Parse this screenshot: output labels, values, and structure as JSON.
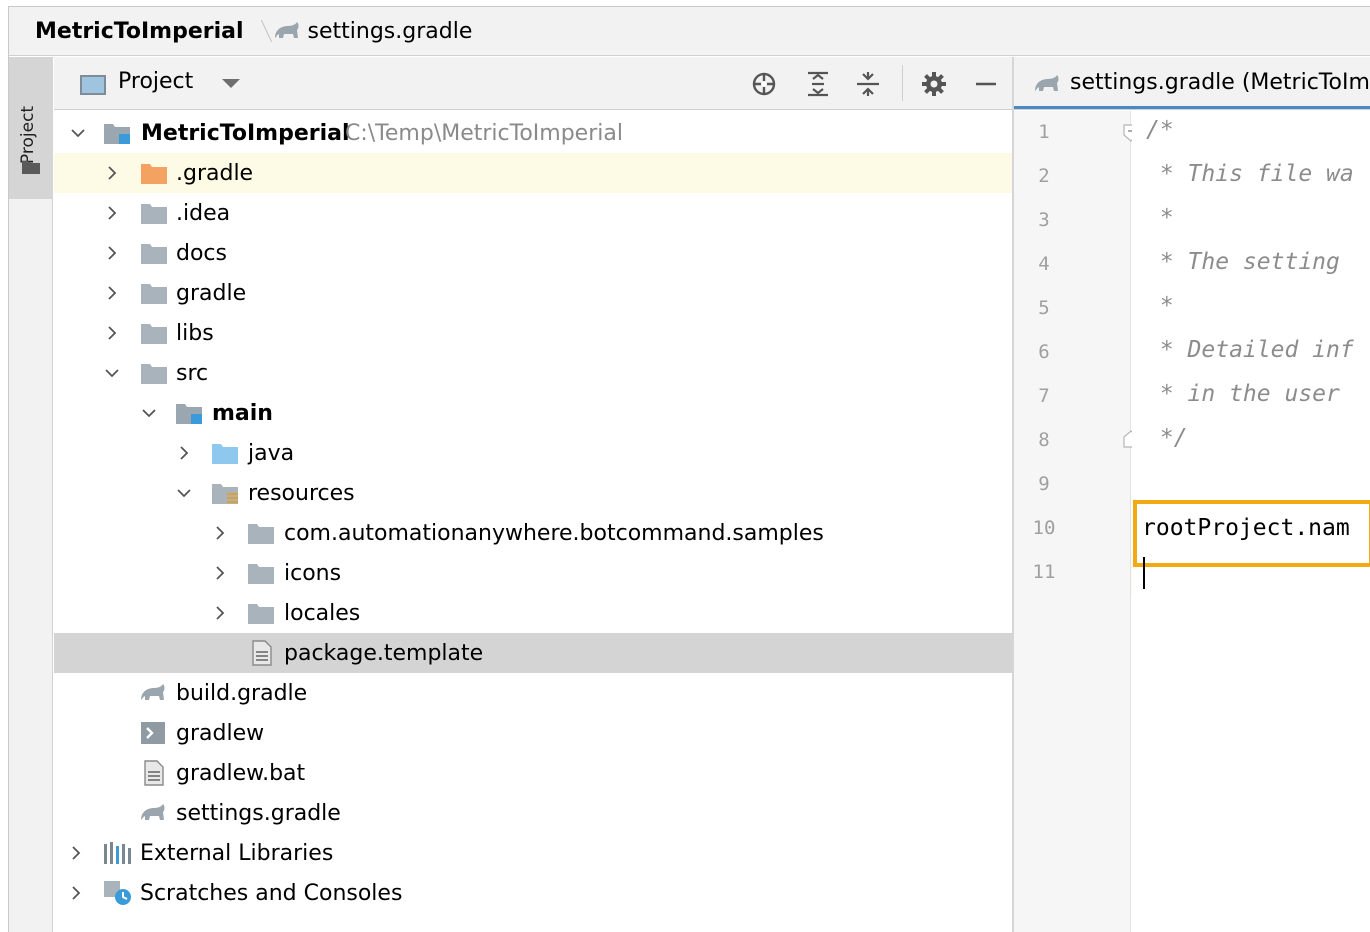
{
  "navbar": {
    "project": "MetricToImperial",
    "file": "settings.gradle"
  },
  "stripe": {
    "label": "Project"
  },
  "project_panel": {
    "title": "Project",
    "toolbar": [
      "locate-icon",
      "expand-all-icon",
      "collapse-all-icon",
      "settings-icon",
      "hide-icon"
    ]
  },
  "tree": {
    "root": {
      "label": "MetricToImperial",
      "path": "C:\\Temp\\MetricToImperial"
    },
    "gradle_dir": ".gradle",
    "idea": ".idea",
    "docs": "docs",
    "gradle": "gradle",
    "libs": "libs",
    "src": "src",
    "main": "main",
    "java": "java",
    "resources": "resources",
    "samples": "com.automationanywhere.botcommand.samples",
    "icons": "icons",
    "locales": "locales",
    "package_template": "package.template",
    "build_gradle": "build.gradle",
    "gradlew": "gradlew",
    "gradlew_bat": "gradlew.bat",
    "settings_gradle": "settings.gradle",
    "external_libraries": "External Libraries",
    "scratches": "Scratches and Consoles"
  },
  "editor": {
    "tab_label": "settings.gradle (MetricToImp",
    "line_numbers": [
      "1",
      "2",
      "3",
      "4",
      "5",
      "6",
      "7",
      "8",
      "9",
      "10",
      "11"
    ],
    "lines": [
      "/*",
      " * This file wa",
      " *",
      " * The setting",
      " *",
      " * Detailed inf",
      " * in the user",
      " */",
      "",
      "rootProject.nam",
      ""
    ]
  },
  "colors": {
    "accent_tab": "#4a88c7",
    "highlight_box": "#f2a914",
    "selection": "#d4d4d4",
    "row_highlight": "#fdfbe6"
  }
}
